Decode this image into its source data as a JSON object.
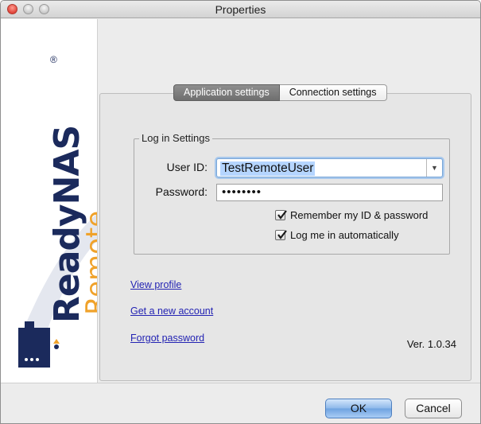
{
  "window": {
    "title": "Properties"
  },
  "branding": {
    "logo_text": "ReadyNAS",
    "reg_mark": "®",
    "sub_text": "Remote"
  },
  "tabs": [
    {
      "label": "Application settings",
      "active": true
    },
    {
      "label": "Connection settings",
      "active": false
    }
  ],
  "login_group": {
    "legend": "Log in Settings",
    "user_id_label": "User ID:",
    "user_id_value": "TestRemoteUser",
    "password_label": "Password:",
    "password_value": "••••••••",
    "remember_label": "Remember my ID & password",
    "remember_checked": true,
    "auto_login_label": "Log me in automatically",
    "auto_login_checked": true
  },
  "links": {
    "view_profile": "View profile",
    "new_account": "Get a new account",
    "forgot_password": "Forgot password"
  },
  "version": "Ver. 1.0.34",
  "buttons": {
    "ok": "OK",
    "cancel": "Cancel"
  },
  "colors": {
    "accent": "#6ea2e0",
    "link": "#2323b3",
    "brand_navy": "#1b2a5c",
    "brand_orange": "#f0a22a"
  }
}
